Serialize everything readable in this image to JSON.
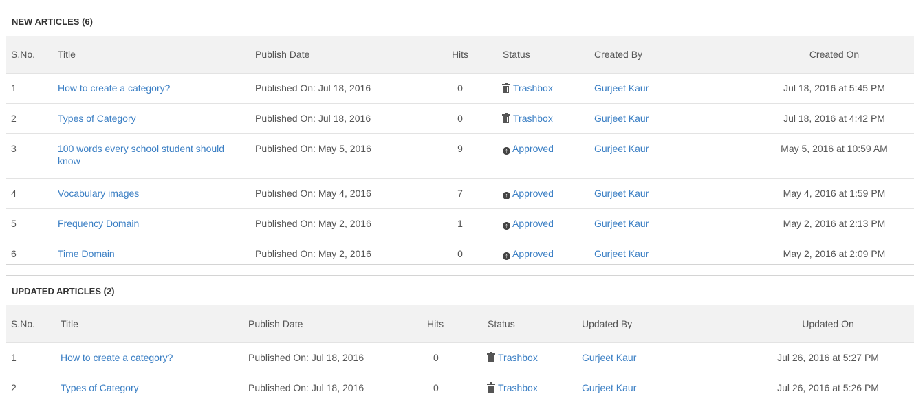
{
  "new_articles": {
    "title": "NEW ARTICLES (6)",
    "headers": [
      "S.No.",
      "Title",
      "Publish Date",
      "Hits",
      "Status",
      "Created By",
      "Created On"
    ],
    "rows": [
      {
        "sno": "1",
        "title": "How to create a category?",
        "publish": "Published On: Jul 18, 2016",
        "hits": "0",
        "status": "Trashbox",
        "status_icon": "trash-icon",
        "by": "Gurjeet Kaur",
        "on": "Jul 18, 2016 at 5:45 PM"
      },
      {
        "sno": "2",
        "title": "Types of Category",
        "publish": "Published On: Jul 18, 2016",
        "hits": "0",
        "status": "Trashbox",
        "status_icon": "trash-icon",
        "by": "Gurjeet Kaur",
        "on": "Jul 18, 2016 at 4:42 PM"
      },
      {
        "sno": "3",
        "title": "100 words every school student should know",
        "publish": "Published On: May 5, 2016",
        "hits": "9",
        "status": "Approved",
        "status_icon": "arrow-up-circle-icon",
        "by": "Gurjeet Kaur",
        "on": "May 5, 2016 at 10:59 AM"
      },
      {
        "sno": "4",
        "title": "Vocabulary images",
        "publish": "Published On: May 4, 2016",
        "hits": "7",
        "status": "Approved",
        "status_icon": "arrow-up-circle-icon",
        "by": "Gurjeet Kaur",
        "on": "May 4, 2016 at 1:59 PM"
      },
      {
        "sno": "5",
        "title": "Frequency Domain",
        "publish": "Published On: May 2, 2016",
        "hits": "1",
        "status": "Approved",
        "status_icon": "arrow-up-circle-icon",
        "by": "Gurjeet Kaur",
        "on": "May 2, 2016 at 2:13 PM"
      },
      {
        "sno": "6",
        "title": "Time Domain",
        "publish": "Published On: May 2, 2016",
        "hits": "0",
        "status": "Approved",
        "status_icon": "arrow-up-circle-icon",
        "by": "Gurjeet Kaur",
        "on": "May 2, 2016 at 2:09 PM"
      }
    ]
  },
  "updated_articles": {
    "title": "UPDATED ARTICLES (2)",
    "headers": [
      "S.No.",
      "Title",
      "Publish Date",
      "Hits",
      "Status",
      "Updated By",
      "Updated On"
    ],
    "rows": [
      {
        "sno": "1",
        "title": "How to create a category?",
        "publish": "Published On: Jul 18, 2016",
        "hits": "0",
        "status": "Trashbox",
        "status_icon": "trash-icon",
        "by": "Gurjeet Kaur",
        "on": "Jul 26, 2016 at 5:27 PM"
      },
      {
        "sno": "2",
        "title": "Types of Category",
        "publish": "Published On: Jul 18, 2016",
        "hits": "0",
        "status": "Trashbox",
        "status_icon": "trash-icon",
        "by": "Gurjeet Kaur",
        "on": "Jul 26, 2016 at 5:26 PM"
      }
    ]
  },
  "colors": {
    "link": "#3b7fc4",
    "header_bg": "#f2f2f2",
    "text": "#555555"
  }
}
